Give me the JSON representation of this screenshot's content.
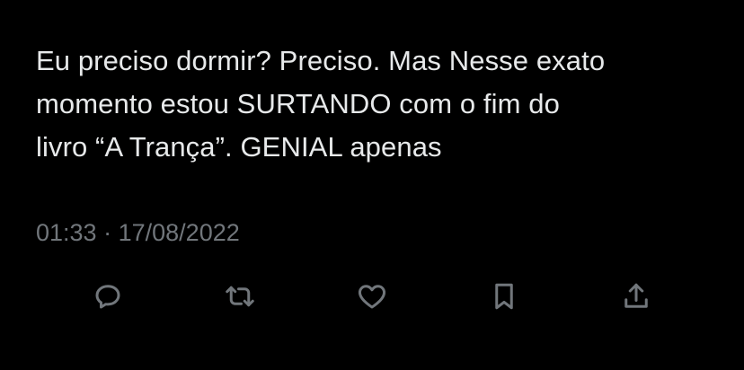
{
  "tweet": {
    "text_lines": [
      "Eu preciso dormir? Preciso. Mas Nesse exato",
      "momento estou SURTANDO com o fim do",
      "livro “A Trança”. GENIAL apenas"
    ],
    "time": "01:33",
    "separator": "·",
    "date": "17/08/2022"
  },
  "actions": [
    {
      "name": "reply",
      "icon": "reply-icon"
    },
    {
      "name": "retweet",
      "icon": "retweet-icon"
    },
    {
      "name": "like",
      "icon": "heart-icon"
    },
    {
      "name": "bookmark",
      "icon": "bookmark-icon"
    },
    {
      "name": "share",
      "icon": "share-icon"
    }
  ],
  "colors": {
    "background": "#000000",
    "text": "#e7e9ea",
    "secondary": "#71767b"
  }
}
